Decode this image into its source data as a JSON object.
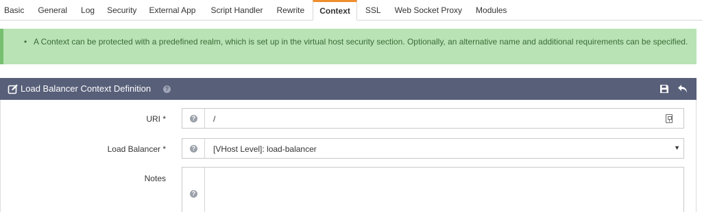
{
  "tabs": [
    {
      "label": "Basic",
      "active": false
    },
    {
      "label": "General",
      "active": false
    },
    {
      "label": "Log",
      "active": false
    },
    {
      "label": "Security",
      "active": false
    },
    {
      "label": "External App",
      "active": false
    },
    {
      "label": "Script Handler",
      "active": false
    },
    {
      "label": "Rewrite",
      "active": false
    },
    {
      "label": "Context",
      "active": true
    },
    {
      "label": "SSL",
      "active": false
    },
    {
      "label": "Web Socket Proxy",
      "active": false
    },
    {
      "label": "Modules",
      "active": false
    }
  ],
  "alert": {
    "text": "A Context can be protected with a predefined realm, which is set up in the virtual host security section. Optionally, an alternative name and additional requirements can be specified."
  },
  "panel": {
    "title": "Load Balancer Context Definition",
    "help_glyph": "?",
    "icons": [
      "edit-icon",
      "help-icon",
      "save-icon",
      "back-icon"
    ]
  },
  "form": {
    "uri": {
      "label": "URI *",
      "value": "/"
    },
    "load_balancer": {
      "label": "Load Balancer *",
      "value": "[VHost Level]: load-balancer"
    },
    "notes": {
      "label": "Notes",
      "value": ""
    }
  },
  "colors": {
    "accent": "#ee8e2e",
    "panel_header": "#585f79",
    "alert_bg": "#b9e3b5",
    "alert_border": "#76c06f"
  }
}
